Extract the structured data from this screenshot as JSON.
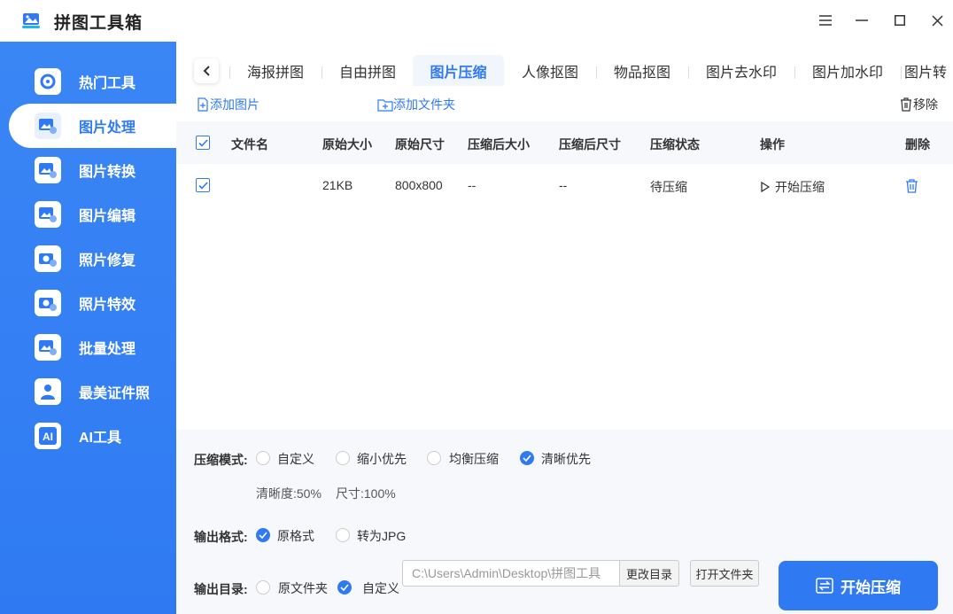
{
  "window": {
    "title": "拼图工具箱"
  },
  "sidebar": {
    "items": [
      {
        "label": "热门工具"
      },
      {
        "label": "图片处理"
      },
      {
        "label": "图片转换"
      },
      {
        "label": "图片编辑"
      },
      {
        "label": "照片修复"
      },
      {
        "label": "照片特效"
      },
      {
        "label": "批量处理"
      },
      {
        "label": "最美证件照"
      },
      {
        "label": "AI工具"
      }
    ],
    "active_index": 1
  },
  "tabs": {
    "items": [
      "海报拼图",
      "自由拼图",
      "图片压缩",
      "人像抠图",
      "物品抠图",
      "图片去水印",
      "图片加水印",
      "图片转"
    ],
    "active_index": 2
  },
  "toolbar": {
    "add_image": "添加图片",
    "add_folder": "添加文件夹",
    "remove": "移除"
  },
  "table": {
    "headers": {
      "filename": "文件名",
      "orig_size": "原始大小",
      "orig_dim": "原始尺寸",
      "comp_size": "压缩后大小",
      "comp_dim": "压缩后尺寸",
      "status": "压缩状态",
      "action": "操作",
      "delete": "删除"
    },
    "rows": [
      {
        "filename": "",
        "orig_size": "21KB",
        "orig_dim": "800x800",
        "comp_size": "--",
        "comp_dim": "--",
        "status": "待压缩",
        "action": "开始压缩"
      }
    ]
  },
  "options": {
    "mode_label": "压缩模式:",
    "modes": [
      "自定义",
      "缩小优先",
      "均衡压缩",
      "清晰优先"
    ],
    "mode_selected": "清晰优先",
    "clarity": "清晰度:50%",
    "size": "尺寸:100%",
    "format_label": "输出格式:",
    "formats": [
      "原格式",
      "转为JPG"
    ],
    "format_selected": "原格式",
    "dir_label": "输出目录:",
    "dirs": [
      "原文件夹",
      "自定义"
    ],
    "dir_selected": "自定义",
    "path_value": "C:\\Users\\Admin\\Desktop\\拼图工具",
    "change_dir": "更改目录",
    "open_folder": "打开文件夹"
  },
  "start_button": "开始压缩",
  "colors": {
    "accent": "#2f7af2",
    "sidebar": "#3a86f5",
    "panel": "#f6f8fb"
  }
}
